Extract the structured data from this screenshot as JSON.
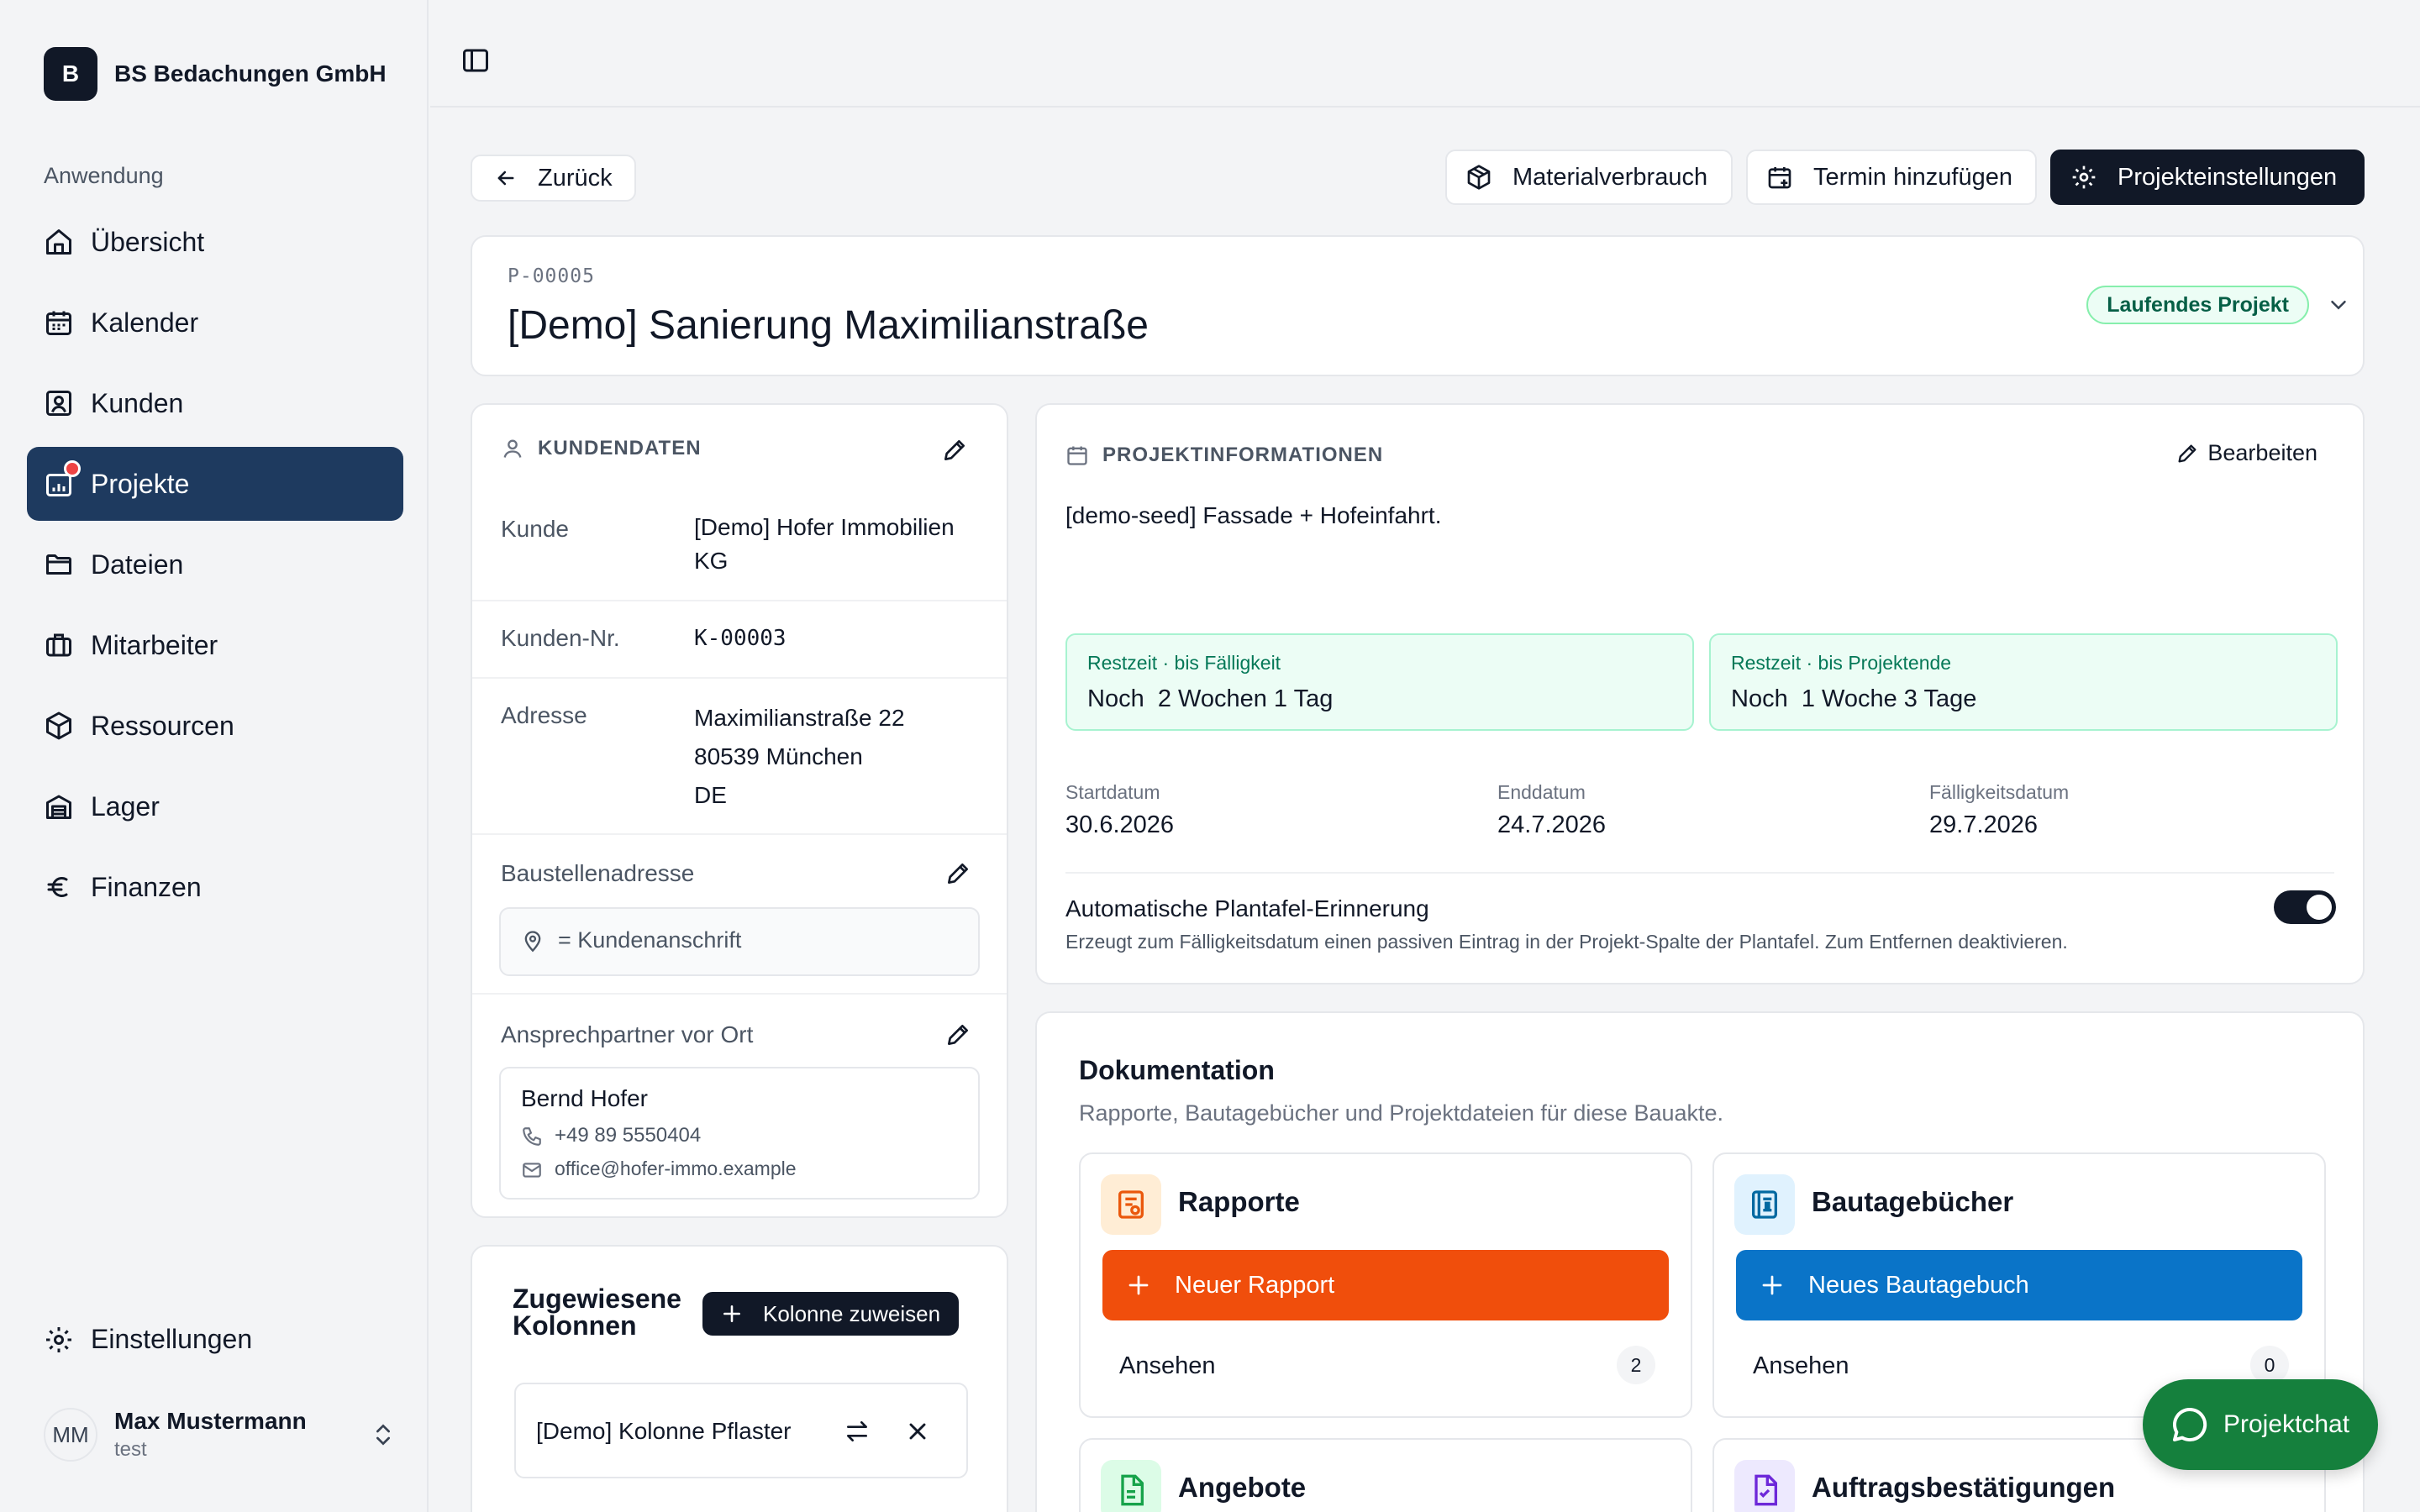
{
  "company": {
    "logo_letter": "B",
    "name": "BS Bedachungen GmbH"
  },
  "sidebar": {
    "section_label": "Anwendung",
    "items": [
      {
        "label": "Übersicht",
        "icon": "home-icon"
      },
      {
        "label": "Kalender",
        "icon": "calendar-icon"
      },
      {
        "label": "Kunden",
        "icon": "contact-icon"
      },
      {
        "label": "Projekte",
        "icon": "projects-icon",
        "active": true
      },
      {
        "label": "Dateien",
        "icon": "folder-icon"
      },
      {
        "label": "Mitarbeiter",
        "icon": "briefcase-icon"
      },
      {
        "label": "Ressourcen",
        "icon": "cube-icon"
      },
      {
        "label": "Lager",
        "icon": "warehouse-icon"
      },
      {
        "label": "Finanzen",
        "icon": "euro-icon"
      }
    ],
    "settings_label": "Einstellungen",
    "user": {
      "initials": "MM",
      "name": "Max Mustermann",
      "subtitle": "test"
    }
  },
  "toolbar": {
    "back_label": "Zurück",
    "material_label": "Materialverbrauch",
    "appointment_label": "Termin hinzufügen",
    "settings_label": "Projekteinstellungen"
  },
  "project": {
    "id": "P-00005",
    "title": "[Demo] Sanierung Maximilianstraße",
    "status": "Laufendes Projekt"
  },
  "customer": {
    "heading": "KUNDENDATEN",
    "customer_label": "Kunde",
    "customer_name_line1": "[Demo] Hofer Immobilien",
    "customer_name_line2": "KG",
    "number_label": "Kunden-Nr.",
    "number": "K-00003",
    "address_label": "Adresse",
    "address_line1": "Maximilianstraße 22",
    "address_line2": "80539 München",
    "address_line3": "DE",
    "site_label": "Baustellenadresse",
    "site_value": "= Kundenanschrift",
    "contact_label": "Ansprechpartner vor Ort",
    "contact_name": "Bernd Hofer",
    "contact_phone": "+49 89 5550404",
    "contact_email": "office@hofer-immo.example"
  },
  "columns": {
    "heading_line1": "Zugewiesene",
    "heading_line2": "Kolonnen",
    "assign_label": "Kolonne zuweisen",
    "items": [
      {
        "name": "[Demo] Kolonne Pflaster"
      }
    ]
  },
  "info": {
    "heading": "PROJEKTINFORMATIONEN",
    "edit_label": "Bearbeiten",
    "description": "[demo-seed] Fassade + Hofeinfahrt.",
    "remaining_due_label": "Restzeit · bis Fälligkeit",
    "remaining_due_value": "Noch  2 Wochen 1 Tag",
    "remaining_end_label": "Restzeit · bis Projektende",
    "remaining_end_value": "Noch  1 Woche 3 Tage",
    "start_label": "Startdatum",
    "start_value": "30.6.2026",
    "end_label": "Enddatum",
    "end_value": "24.7.2026",
    "due_label": "Fälligkeitsdatum",
    "due_value": "29.7.2026",
    "reminder_title": "Automatische Plantafel-Erinnerung",
    "reminder_desc": "Erzeugt zum Fälligkeitsdatum einen passiven Eintrag in der Projekt-Spalte der Plantafel. Zum Entfernen deaktivieren.",
    "reminder_enabled": true
  },
  "documentation": {
    "heading": "Dokumentation",
    "subheading": "Rapporte, Bautagebücher und Projektdateien für diese Bauakte.",
    "tiles": [
      {
        "title": "Rapporte",
        "button": "Neuer Rapport",
        "view": "Ansehen",
        "count": "2",
        "color": "#f04e0c"
      },
      {
        "title": "Bautagebücher",
        "button": "Neues Bautagebuch",
        "view": "Ansehen",
        "count": "0",
        "color": "#0a74c8"
      },
      {
        "title": "Angebote",
        "color": "#16a34a"
      },
      {
        "title": "Auftragsbestätigungen",
        "color": "#6d28d9"
      }
    ]
  },
  "chat": {
    "label": "Projektchat"
  }
}
